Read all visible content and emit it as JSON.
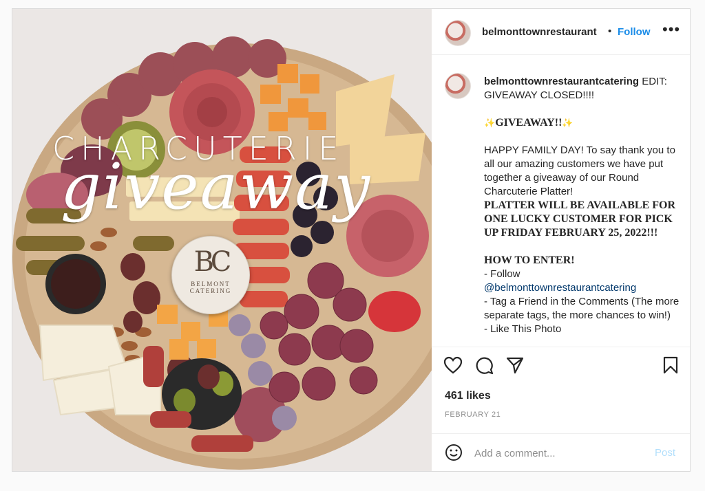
{
  "post": {
    "username": "belmonttownrestaurant",
    "separator": "•",
    "follow_label": "Follow",
    "more_label": "•••"
  },
  "image": {
    "overlay_title": "CHARCUTERIE",
    "overlay_script": "giveaway",
    "logo_monogram": "BC",
    "logo_text": "BELMONT CATERING"
  },
  "caption": {
    "username": "belmonttownrestaurantcatering",
    "line1": "EDIT: GIVEAWAY CLOSED!!!!",
    "sparkle": "✨",
    "giveaway_heading": "GIVEAWAY!!",
    "body1": "HAPPY FAMILY DAY! To say thank you to all our amazing customers we have put together a giveaway of our Round Charcuterie Platter!",
    "body2": "PLATTER WILL BE AVAILABLE FOR ONE LUCKY CUSTOMER FOR PICK UP FRIDAY FEBRUARY 25, 2022!!!",
    "how_heading": "HOW TO ENTER!",
    "step1": "- Follow",
    "mention": "@belmonttownrestaurantcatering",
    "step2": "- Tag a Friend in the Comments (The more separate tags, the more chances to win!)",
    "step3": "- Like This Photo"
  },
  "stats": {
    "likes": "461 likes",
    "date": "FEBRUARY 21"
  },
  "comment": {
    "placeholder": "Add a comment...",
    "post_label": "Post"
  },
  "icons": {
    "like": "heart-icon",
    "comment": "comment-icon",
    "share": "share-icon",
    "save": "bookmark-icon",
    "emoji": "emoji-icon",
    "more": "more-icon"
  },
  "colors": {
    "link_blue": "#1a8ce8",
    "post_disabled": "#b2dffc",
    "muted": "#8e8e8e"
  }
}
